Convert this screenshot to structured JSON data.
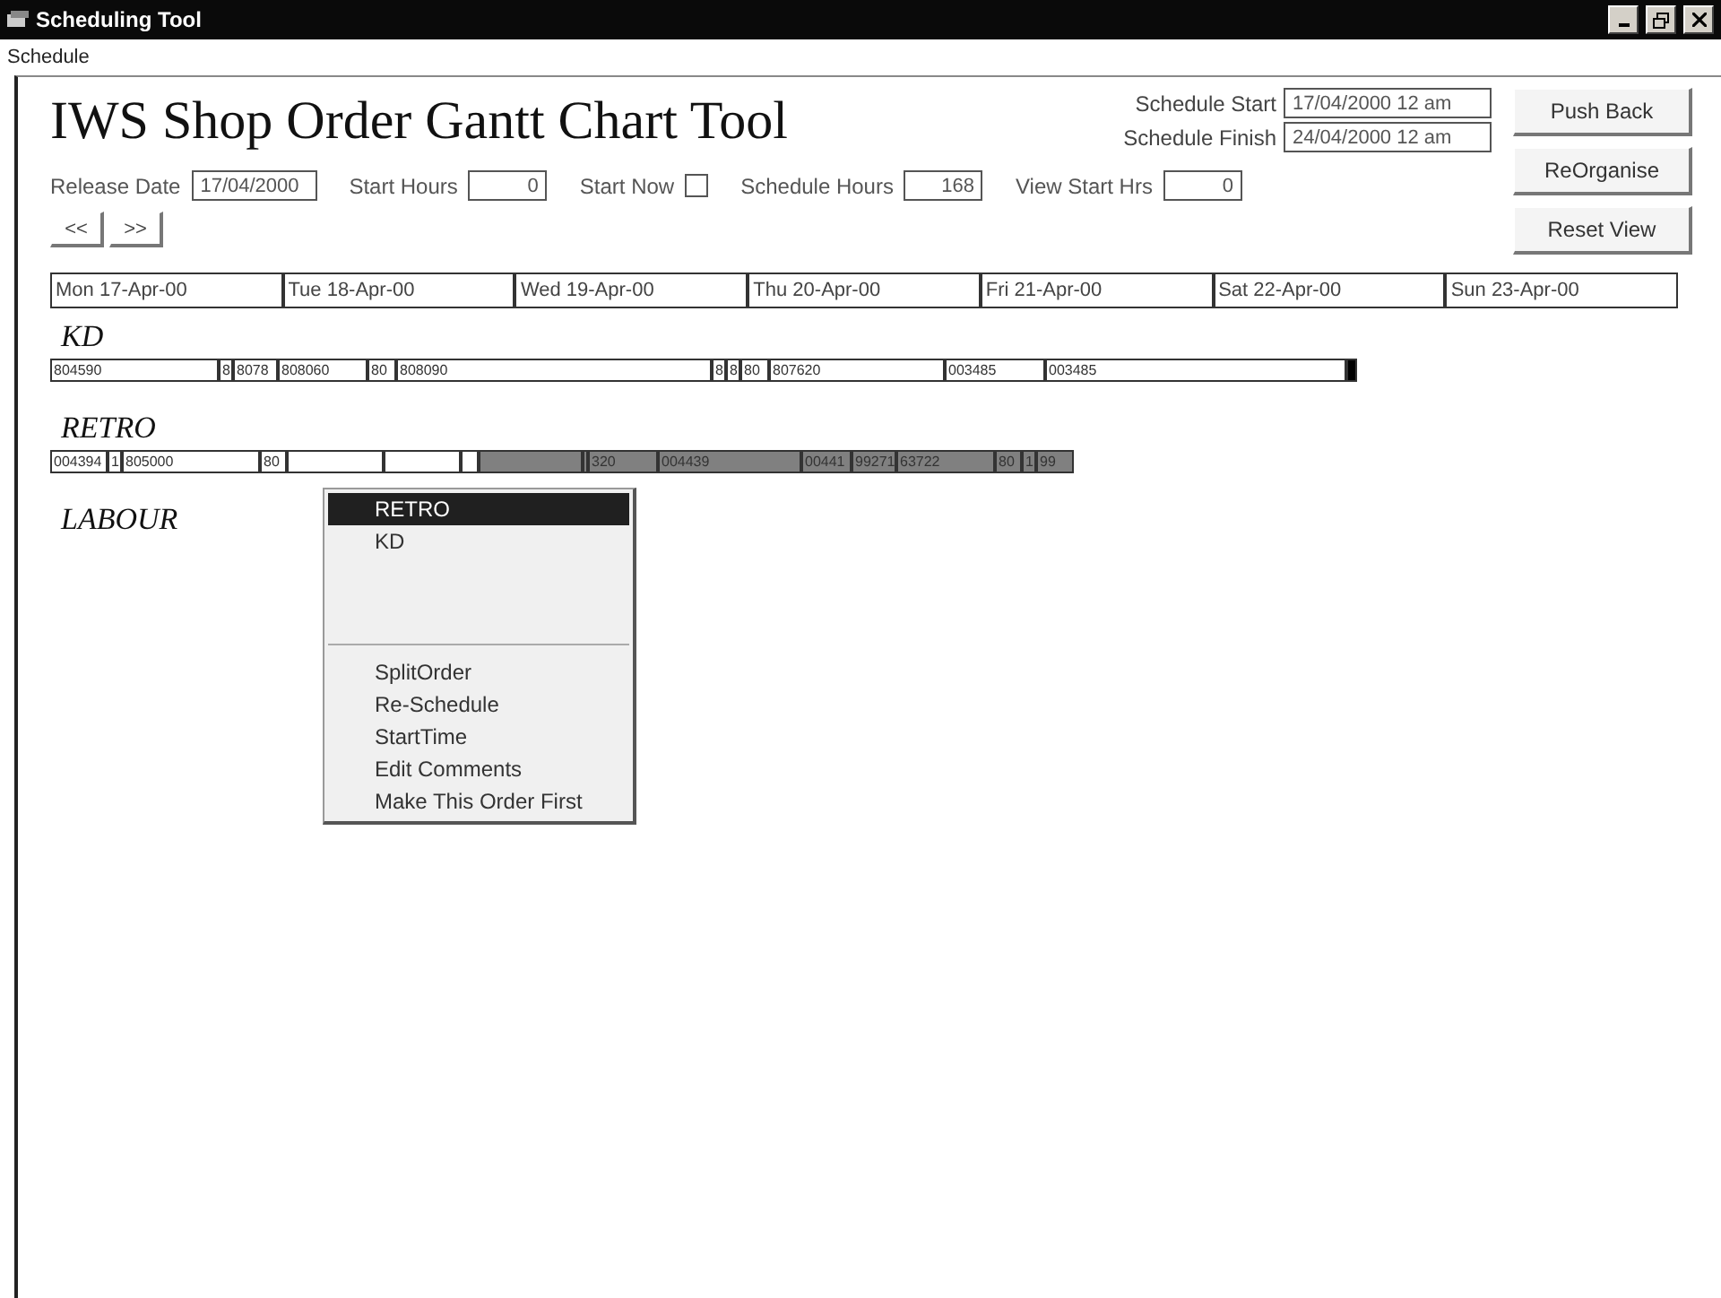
{
  "window": {
    "title": "Scheduling Tool"
  },
  "menubar": [
    "Schedule"
  ],
  "heading": "IWS Shop Order Gantt Chart Tool",
  "schedule_start": {
    "label": "Schedule Start",
    "value": "17/04/2000 12 am"
  },
  "schedule_finish": {
    "label": "Schedule Finish",
    "value": "24/04/2000 12 am"
  },
  "buttons": [
    "Push Back",
    "ReOrganise",
    "Reset View"
  ],
  "params": [
    {
      "kind": "field",
      "label": "Release Date",
      "value": "17/04/2000"
    },
    {
      "kind": "field",
      "label": "Start Hours",
      "value": "0"
    },
    {
      "kind": "checkbox",
      "label": "Start Now",
      "checked": false
    },
    {
      "kind": "field",
      "label": "Schedule Hours",
      "value": "168"
    },
    {
      "kind": "field",
      "label": "View Start Hrs",
      "value": "0"
    }
  ],
  "nav": [
    "<<",
    ">>"
  ],
  "days": [
    "Mon 17-Apr-00",
    "Tue 18-Apr-00",
    "Wed 19-Apr-00",
    "Thu 20-Apr-00",
    "Fri 21-Apr-00",
    "Sat 22-Apr-00",
    "Sun 23-Apr-00"
  ],
  "groups": [
    {
      "name": "KD",
      "segments": [
        {
          "label": "804590",
          "color": "#ffffff"
        },
        {
          "label": "8",
          "color": "#ffffff"
        },
        {
          "label": "8078",
          "color": "#ffffff"
        },
        {
          "label": "808060",
          "color": "#ffffff"
        },
        {
          "label": "80",
          "color": "#ffffff"
        },
        {
          "label": "808090",
          "color": "#ffffff"
        },
        {
          "label": "8",
          "color": "#ffffff"
        },
        {
          "label": "8",
          "color": "#ffffff"
        },
        {
          "label": "80",
          "color": "#ffffff"
        },
        {
          "label": "807620",
          "color": "#ffffff"
        },
        {
          "label": "003485",
          "color": "#ffffff"
        },
        {
          "label": "003485",
          "color": "#ffffff"
        },
        {
          "color": "#000000"
        }
      ]
    },
    {
      "name": "RETRO",
      "segments": [
        {
          "label": "004394",
          "color": "#ffffff"
        },
        {
          "label": "1",
          "color": "#ffffff"
        },
        {
          "label": "805000",
          "color": "#ffffff"
        },
        {
          "label": "80",
          "color": "#ffffff"
        },
        {
          "color": "#ffffff"
        },
        {
          "color": "#ffffff"
        },
        {
          "color": "#ffffff"
        },
        {
          "color": "#808080"
        },
        {
          "color": "#808080"
        },
        {
          "label": "320",
          "color": "#808080"
        },
        {
          "label": "004439",
          "color": "#808080"
        },
        {
          "label": "00441",
          "color": "#808080"
        },
        {
          "label": "99271",
          "color": "#808080"
        },
        {
          "label": "63722",
          "color": "#808080"
        },
        {
          "label": "80",
          "color": "#808080"
        },
        {
          "label": "1",
          "color": "#808080"
        },
        {
          "label": "99",
          "color": "#808080"
        }
      ]
    },
    {
      "name": "LABOUR"
    }
  ],
  "context_menu": {
    "items": [
      {
        "kind": "item",
        "label": "RETRO",
        "selected": true
      },
      {
        "kind": "item",
        "label": "KD",
        "selected": false
      },
      {
        "kind": "blank"
      },
      {
        "kind": "separator"
      },
      {
        "kind": "item",
        "label": "SplitOrder",
        "selected": false
      },
      {
        "kind": "item",
        "label": "Re-Schedule",
        "selected": false
      },
      {
        "kind": "item",
        "label": "StartTime",
        "selected": false
      },
      {
        "kind": "item",
        "label": "Edit Comments",
        "selected": false
      },
      {
        "kind": "item",
        "label": "Make This Order First",
        "selected": false
      }
    ]
  }
}
